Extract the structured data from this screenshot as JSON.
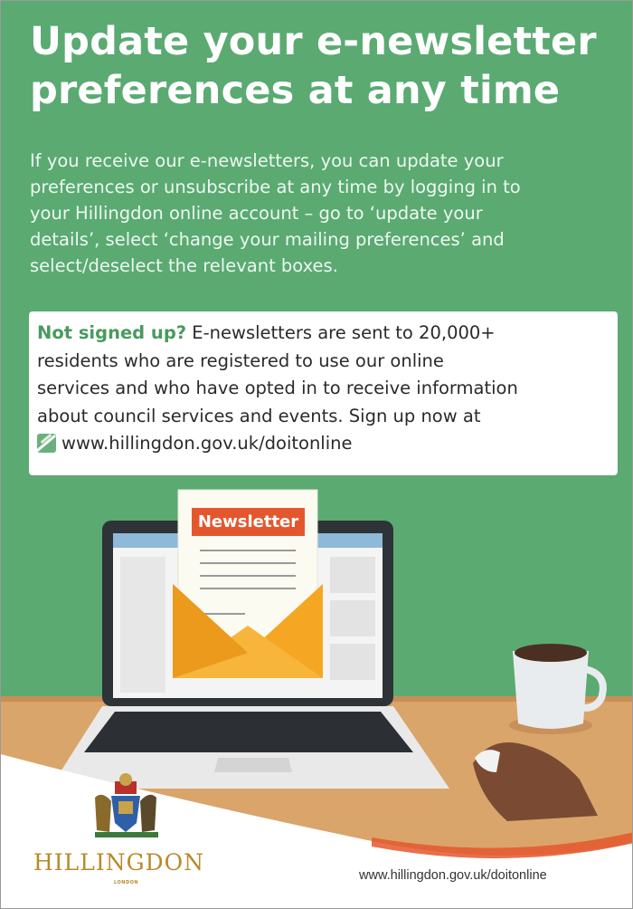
{
  "heading": {
    "lines": [
      "Update your e-newsletter",
      "preferences at any time"
    ]
  },
  "intro": {
    "lines": [
      "If you receive our e-newsletters, you can update your",
      "preferences or unsubscribe at any time by logging in to",
      "your Hillingdon online account – go to ‘update your",
      "details’, select ‘change your mailing preferences’ and",
      "select/deselect the relevant boxes."
    ]
  },
  "signup_box": {
    "lead": "Not signed up?",
    "line1_rest": " E-newsletters are sent to 20,000+",
    "lines": [
      "residents who are registered to use our online",
      "services and who have opted in to receive information",
      "about council services and events. Sign up now at"
    ],
    "url": "www.hillingdon.gov.uk/doitonline",
    "icon": "hillingdon-leaf-icon"
  },
  "illustration": {
    "newsletter_label": "Newsletter",
    "colors": {
      "background": "#5aaa72",
      "desk": "#d9a56a",
      "envelope": "#f5a623",
      "label": "#e4572e"
    }
  },
  "footer": {
    "logo_text": "HILLINGDON",
    "logo_sub": "LONDON",
    "url": "www.hillingdon.gov.uk/doitonline"
  }
}
